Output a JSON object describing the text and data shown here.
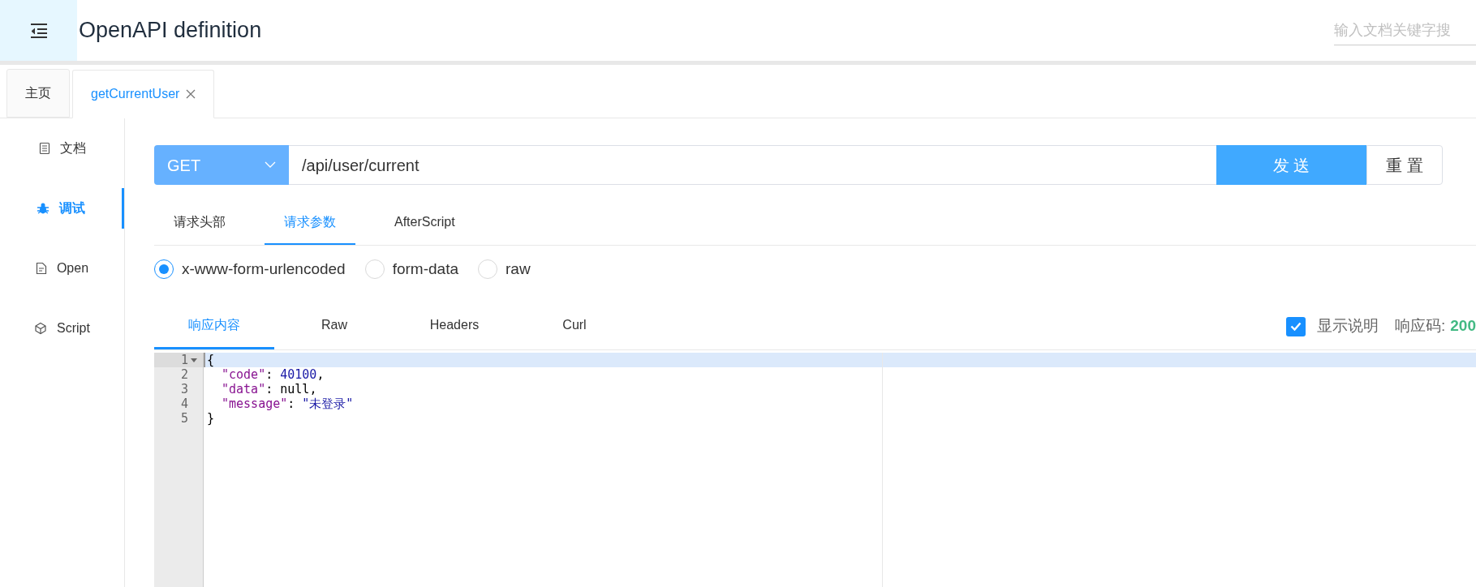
{
  "header": {
    "title": "OpenAPI definition",
    "search": {
      "placeholder": "输入文档关键字搜"
    }
  },
  "tabs": [
    {
      "label": "主页",
      "selected": false,
      "closable": false
    },
    {
      "label": "getCurrentUser",
      "selected": true,
      "closable": true
    }
  ],
  "sidebar": {
    "items": [
      {
        "label": "文档",
        "selected": false
      },
      {
        "label": "调试",
        "selected": true
      },
      {
        "label": "Open",
        "selected": false
      },
      {
        "label": "Script",
        "selected": false
      }
    ]
  },
  "request": {
    "method": "GET",
    "url": "/api/user/current",
    "send": "发 送",
    "reset": "重 置"
  },
  "request_tabs": [
    {
      "label": "请求头部",
      "selected": false
    },
    {
      "label": "请求参数",
      "selected": true
    },
    {
      "label": "AfterScript",
      "selected": false
    }
  ],
  "body_types": [
    {
      "label": "x-www-form-urlencoded",
      "selected": true
    },
    {
      "label": "form-data",
      "selected": false
    },
    {
      "label": "raw",
      "selected": false
    }
  ],
  "response_tabs": [
    {
      "label": "响应内容",
      "selected": true
    },
    {
      "label": "Raw",
      "selected": false
    },
    {
      "label": "Headers",
      "selected": false
    },
    {
      "label": "Curl",
      "selected": false
    }
  ],
  "show_description": {
    "label": "显示说明",
    "checked": true
  },
  "status": {
    "label": "响应码:",
    "code": "200"
  },
  "editor": {
    "lines": [
      {
        "number": "1",
        "active": true,
        "foldable": true,
        "indented": false,
        "tokens": [
          {
            "text": "{",
            "kind": "punct"
          }
        ]
      },
      {
        "number": "2",
        "active": false,
        "foldable": false,
        "indented": true,
        "tokens": [
          {
            "text": "\"code\"",
            "kind": "key"
          },
          {
            "text": ": ",
            "kind": "punct"
          },
          {
            "text": "40100",
            "kind": "number"
          },
          {
            "text": ",",
            "kind": "punct"
          }
        ]
      },
      {
        "number": "3",
        "active": false,
        "foldable": false,
        "indented": true,
        "tokens": [
          {
            "text": "\"data\"",
            "kind": "key"
          },
          {
            "text": ": ",
            "kind": "punct"
          },
          {
            "text": "null",
            "kind": "null"
          },
          {
            "text": ",",
            "kind": "punct"
          }
        ]
      },
      {
        "number": "4",
        "active": false,
        "foldable": false,
        "indented": true,
        "tokens": [
          {
            "text": "\"message\"",
            "kind": "key"
          },
          {
            "text": ": ",
            "kind": "punct"
          },
          {
            "text": "\"未登录\"",
            "kind": "string"
          }
        ]
      },
      {
        "number": "5",
        "active": false,
        "foldable": false,
        "indented": false,
        "tokens": [
          {
            "text": "}",
            "kind": "punct"
          }
        ]
      }
    ]
  }
}
